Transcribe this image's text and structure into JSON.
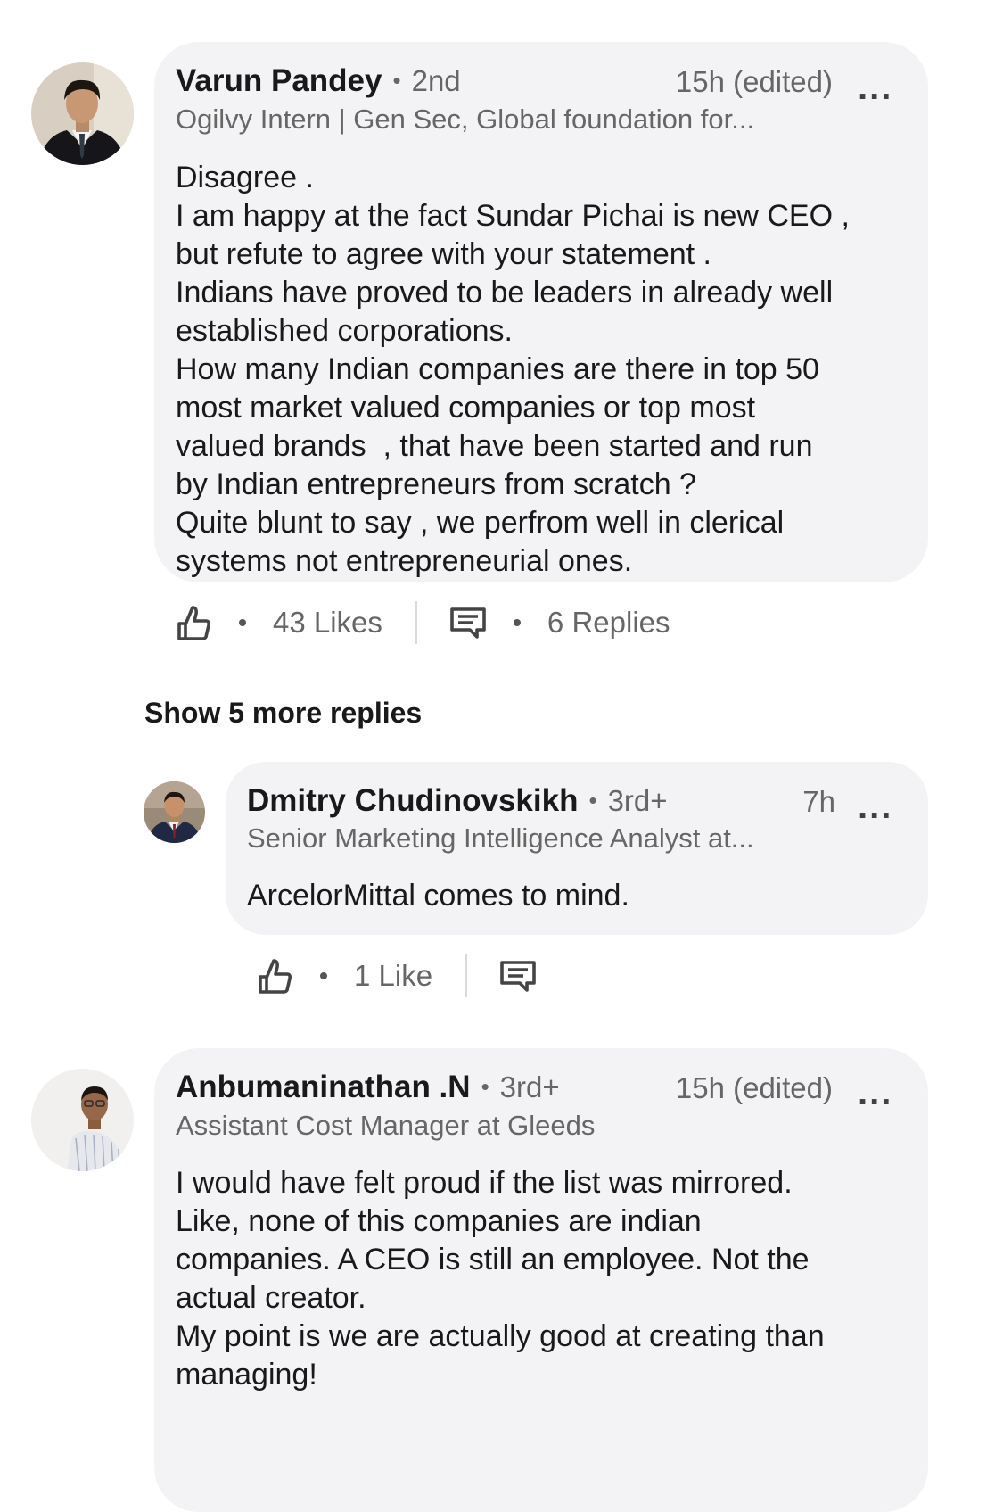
{
  "comments": [
    {
      "author": "Varun Pandey",
      "degree": "2nd",
      "time": "15h (edited)",
      "headline": "Ogilvy Intern | Gen Sec, Global foundation for...",
      "body": "Disagree .\nI am happy at the fact Sundar Pichai is new CEO ,\nbut refute to agree with your statement .\nIndians have proved to be leaders in already well\nestablished corporations.\nHow many Indian companies are there in top 50\nmost market valued companies or top most\nvalued brands  , that have been started and run\nby Indian entrepreneurs from scratch ?\nQuite blunt to say , we perfrom well in clerical\nsystems not entrepreneurial ones.",
      "likes_label": "43 Likes",
      "replies_label": "6 Replies"
    },
    {
      "author": "Anbumaninathan .N",
      "degree": "3rd+",
      "time": "15h (edited)",
      "headline": "Assistant Cost Manager at Gleeds",
      "body": "I would have felt proud if the list was mirrored.\nLike, none of this companies are indian\ncompanies. A CEO is still an employee. Not the\nactual creator.\nMy point is we are actually good at creating than\nmanaging!"
    }
  ],
  "show_more_label": "Show 5 more replies",
  "reply": {
    "author": "Dmitry Chudinovskikh",
    "degree": "3rd+",
    "time": "7h",
    "headline": "Senior Marketing Intelligence Analyst at...",
    "body": "ArcelorMittal comes to mind.",
    "likes_label": "1 Like"
  },
  "dot_separator": "•",
  "more_glyph": "...",
  "icons": {
    "like": "thumbs-up-icon",
    "reply": "comment-icon",
    "more": "more-options-icon"
  },
  "colors": {
    "bubble": "#f3f3f5",
    "secondary_text": "#666666",
    "primary_text": "#191919"
  }
}
